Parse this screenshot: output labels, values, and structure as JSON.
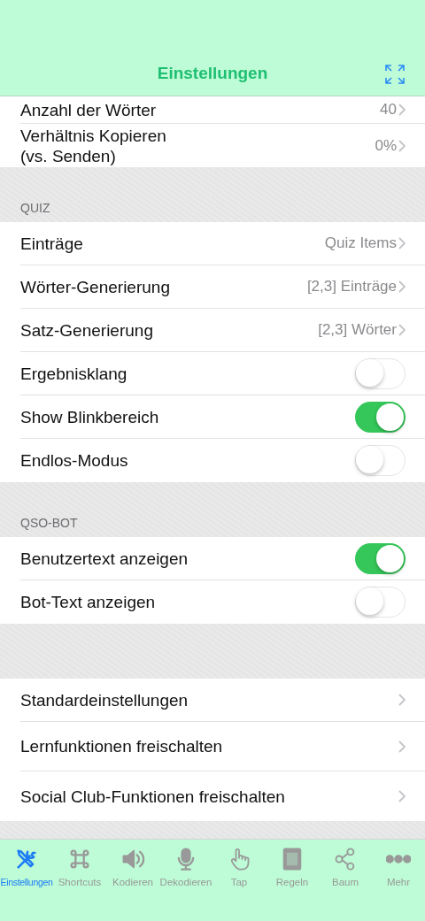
{
  "nav_bar": {
    "title": "Einstellungen"
  },
  "sections": [
    {
      "rows": [
        {
          "kind": "value",
          "label": "Anzahl der Wörter",
          "value": "40"
        },
        {
          "kind": "value",
          "label": "Verhältnis Kopieren\n(vs. Senden)",
          "value": "0%"
        }
      ]
    },
    {
      "header": "QUIZ",
      "rows": [
        {
          "kind": "value",
          "label": "Einträge",
          "value": "Quiz Items"
        },
        {
          "kind": "value",
          "label": "Wörter-Generierung",
          "value": "[2,3] Einträge"
        },
        {
          "kind": "value",
          "label": "Satz-Generierung",
          "value": "[2,3] Wörter"
        },
        {
          "kind": "toggle",
          "label": "Ergebnisklang",
          "on": false
        },
        {
          "kind": "toggle",
          "label": "Show Blinkbereich",
          "on": true
        },
        {
          "kind": "toggle",
          "label": "Endlos-Modus",
          "on": false
        }
      ]
    },
    {
      "header": "QSO-BOT",
      "rows": [
        {
          "kind": "toggle",
          "label": "Benutzertext anzeigen",
          "on": true
        },
        {
          "kind": "toggle",
          "label": "Bot-Text anzeigen",
          "on": false
        }
      ]
    },
    {
      "rows": [
        {
          "kind": "link",
          "label": "Standardeinstellungen"
        },
        {
          "kind": "link",
          "label": "Lernfunktionen freischalten"
        },
        {
          "kind": "link",
          "label": "Social Club-Funktionen freischalten"
        }
      ]
    }
  ],
  "tab_bar": [
    {
      "label": "Einstellungen",
      "selected": true
    },
    {
      "label": "Shortcuts",
      "selected": false
    },
    {
      "label": "Kodieren",
      "selected": false
    },
    {
      "label": "Dekodieren",
      "selected": false
    },
    {
      "label": "Tap",
      "selected": false
    },
    {
      "label": "Regeln",
      "selected": false
    },
    {
      "label": "Baum",
      "selected": false
    },
    {
      "label": "Mehr",
      "selected": false
    }
  ]
}
